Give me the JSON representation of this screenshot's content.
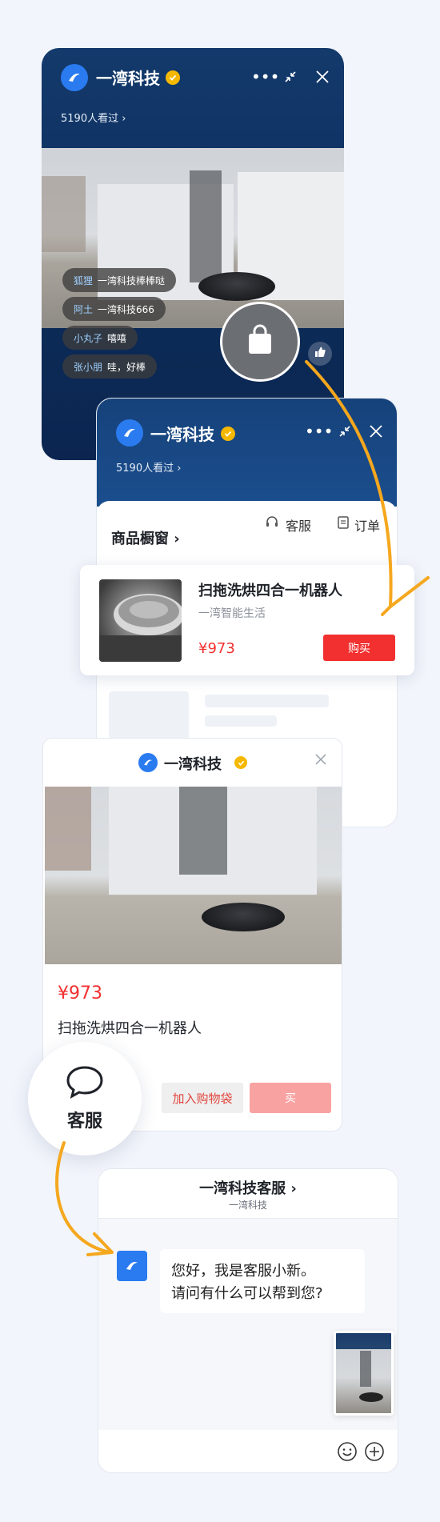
{
  "brand": {
    "name": "一湾科技",
    "viewers": "5190人看过 ›"
  },
  "live_room": {
    "comments": [
      {
        "nick": "狐狸",
        "text": "一湾科技棒棒哒"
      },
      {
        "nick": "阿土",
        "text": "一湾科技666"
      },
      {
        "nick": "小丸子",
        "text": "嘻嘻"
      },
      {
        "nick": "张小朋",
        "text": "哇，好棒"
      }
    ],
    "like_count": "..."
  },
  "shop": {
    "title": "商品橱窗 ›",
    "customer_service": "客服",
    "orders": "订单",
    "product": {
      "name": "扫拖洗烘四合一机器人",
      "seller": "一湾智能生活",
      "price": "¥973",
      "buy_label": "购买"
    }
  },
  "detail": {
    "shop_name": "一湾科技",
    "price": "¥973",
    "product_name": "扫拖洗烘四合一机器人",
    "add_to_cart": "加入购物袋",
    "buy": "买"
  },
  "service_bubble": {
    "label": "客服"
  },
  "chat": {
    "title": "一湾科技客服 ›",
    "subtitle": "一湾科技",
    "message_line1": "您好，我是客服小新。",
    "message_line2": "请问有什么可以帮到您?"
  },
  "colors": {
    "accent_blue": "#2a7bf0",
    "price_red": "#f23030",
    "arrow_orange": "#f5a71e",
    "verified_gold": "#f5b800"
  },
  "icons": [
    "ellipsis-icon",
    "minimize-icon",
    "close-icon",
    "shopping-bag-icon",
    "thumbs-up-icon",
    "headset-icon",
    "clipboard-icon",
    "speech-bubble-icon",
    "emoji-icon",
    "plus-icon"
  ]
}
